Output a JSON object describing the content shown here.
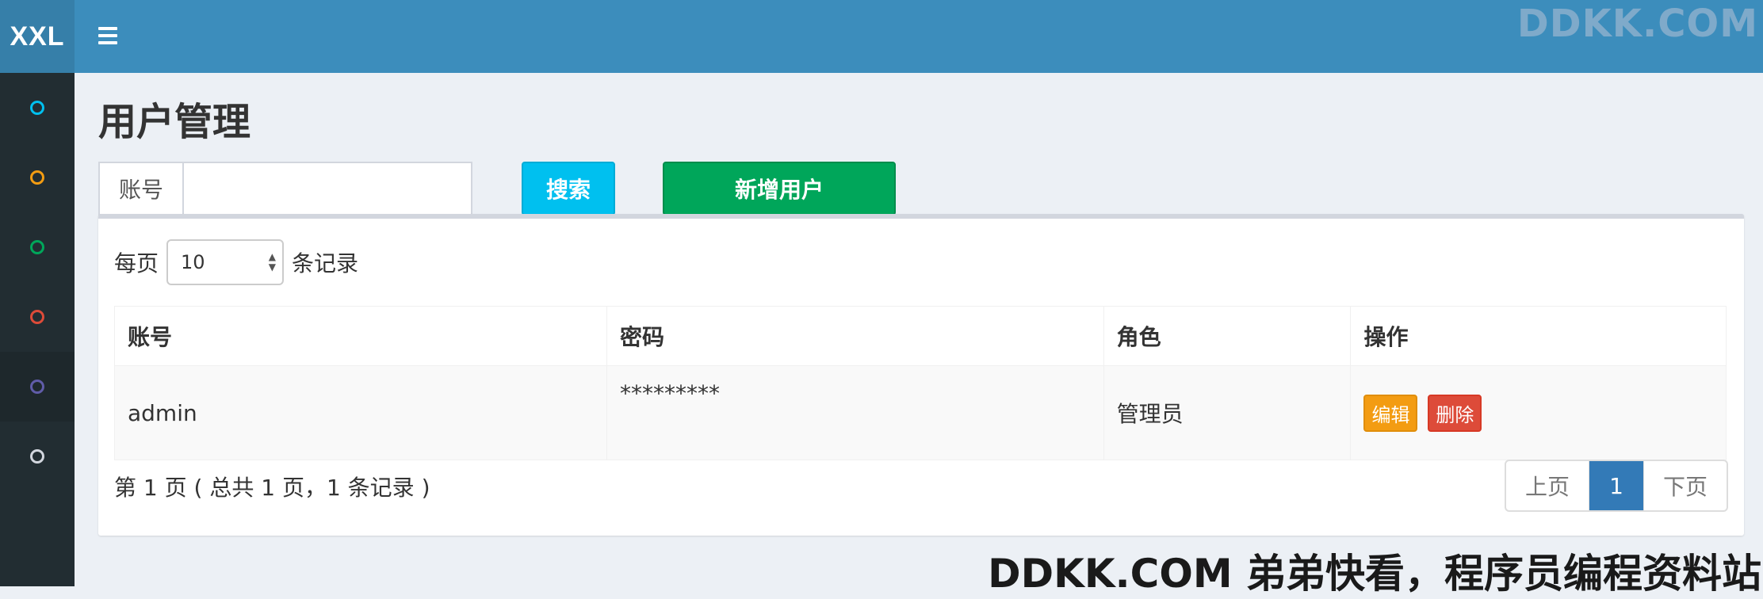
{
  "header": {
    "logo": "XXL",
    "user_menu": ""
  },
  "sidebar": {
    "items": [
      {
        "color": "#00c0ef"
      },
      {
        "color": "#f39c12"
      },
      {
        "color": "#00a65a"
      },
      {
        "color": "#dd4b39"
      },
      {
        "color": "#605ca8",
        "active": true
      },
      {
        "color": "#d2d6de"
      }
    ]
  },
  "page": {
    "title": "用户管理"
  },
  "search": {
    "label": "账号",
    "value": "",
    "button": "搜索"
  },
  "add_button": "新增用户",
  "length": {
    "prefix": "每页",
    "value": "10",
    "suffix": "条记录"
  },
  "table": {
    "headers": [
      "账号",
      "密码",
      "角色",
      "操作"
    ],
    "rows": [
      {
        "account": "admin",
        "password": "*********",
        "role": "管理员",
        "edit": "编辑",
        "delete": "删除"
      }
    ]
  },
  "pagination": {
    "info": "第 1 页 ( 总共 1 页，1 条记录 )",
    "prev": "上页",
    "current": "1",
    "next": "下页"
  },
  "watermark": {
    "top": "DDKK.COM",
    "bottom": "DDKK.COM 弟弟快看，程序员编程资料站"
  }
}
